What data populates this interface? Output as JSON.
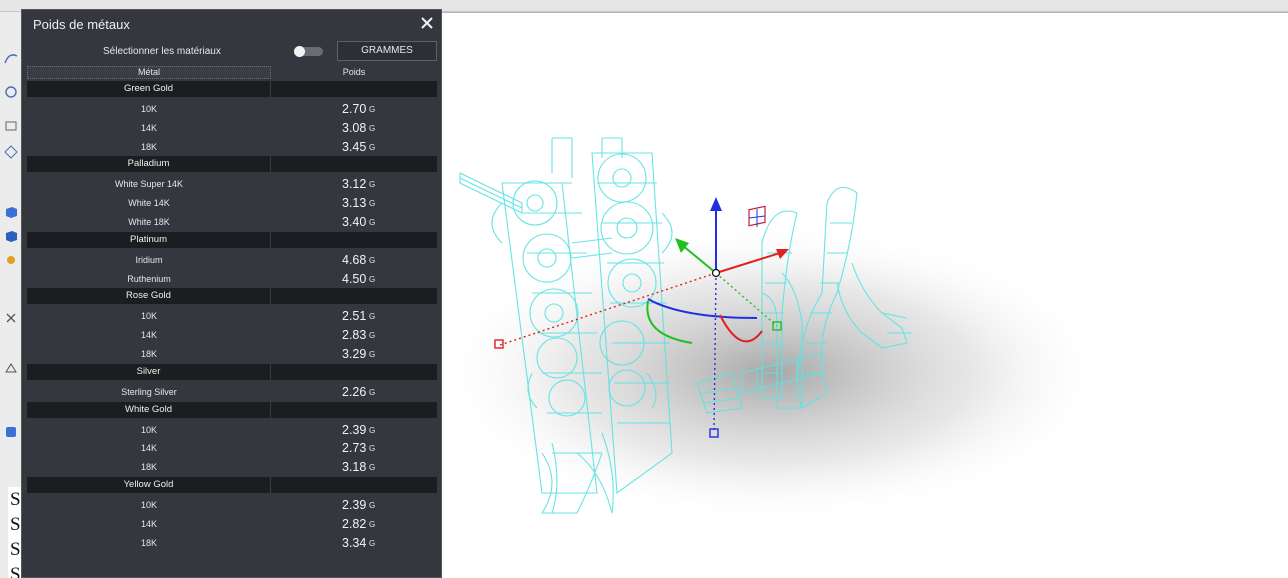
{
  "panel": {
    "title": "Poids de métaux",
    "select_materials_label": "Sélectionner les matériaux",
    "unit_button_label": "GRAMMES",
    "toggle_state": "off",
    "close_icon": "close-icon",
    "columns": {
      "metal": "Métal",
      "weight": "Poids"
    },
    "groups": [
      {
        "name": "Green Gold",
        "items": [
          {
            "name": "10K",
            "value": "2.70",
            "unit": "G"
          },
          {
            "name": "14K",
            "value": "3.08",
            "unit": "G"
          },
          {
            "name": "18K",
            "value": "3.45",
            "unit": "G"
          }
        ]
      },
      {
        "name": "Palladium",
        "items": [
          {
            "name": "White Super 14K",
            "value": "3.12",
            "unit": "G"
          },
          {
            "name": "White 14K",
            "value": "3.13",
            "unit": "G"
          },
          {
            "name": "White 18K",
            "value": "3.40",
            "unit": "G"
          }
        ]
      },
      {
        "name": "Platinum",
        "items": [
          {
            "name": "Iridium",
            "value": "4.68",
            "unit": "G"
          },
          {
            "name": "Ruthenium",
            "value": "4.50",
            "unit": "G"
          }
        ]
      },
      {
        "name": "Rose Gold",
        "items": [
          {
            "name": "10K",
            "value": "2.51",
            "unit": "G"
          },
          {
            "name": "14K",
            "value": "2.83",
            "unit": "G"
          },
          {
            "name": "18K",
            "value": "3.29",
            "unit": "G"
          }
        ]
      },
      {
        "name": "Silver",
        "items": [
          {
            "name": "Sterling Silver",
            "value": "2.26",
            "unit": "G"
          }
        ]
      },
      {
        "name": "White Gold",
        "items": [
          {
            "name": "10K",
            "value": "2.39",
            "unit": "G"
          },
          {
            "name": "14K",
            "value": "2.73",
            "unit": "G"
          },
          {
            "name": "18K",
            "value": "3.18",
            "unit": "G"
          }
        ]
      },
      {
        "name": "Yellow Gold",
        "items": [
          {
            "name": "10K",
            "value": "2.39",
            "unit": "G"
          },
          {
            "name": "14K",
            "value": "2.82",
            "unit": "G"
          },
          {
            "name": "18K",
            "value": "3.34",
            "unit": "G"
          }
        ]
      }
    ]
  },
  "command_history": {
    "visible_letters": [
      "S",
      "S",
      "S",
      "S"
    ]
  },
  "viewport": {
    "wireframe_color": "#5fe3e3",
    "gizmo_colors": {
      "x": "#e02020",
      "y": "#20c020",
      "z": "#2030e0"
    },
    "gizmo_icons": [
      "move-x-arrow-icon",
      "move-y-arrow-icon",
      "move-z-arrow-icon",
      "rotate-arc-icon",
      "scale-handle-icon",
      "plane-handle-icon"
    ]
  },
  "colors": {
    "panel_bg": "#35373e",
    "group_row_bg": "#1c1d21",
    "text": "#e6e6e6"
  }
}
